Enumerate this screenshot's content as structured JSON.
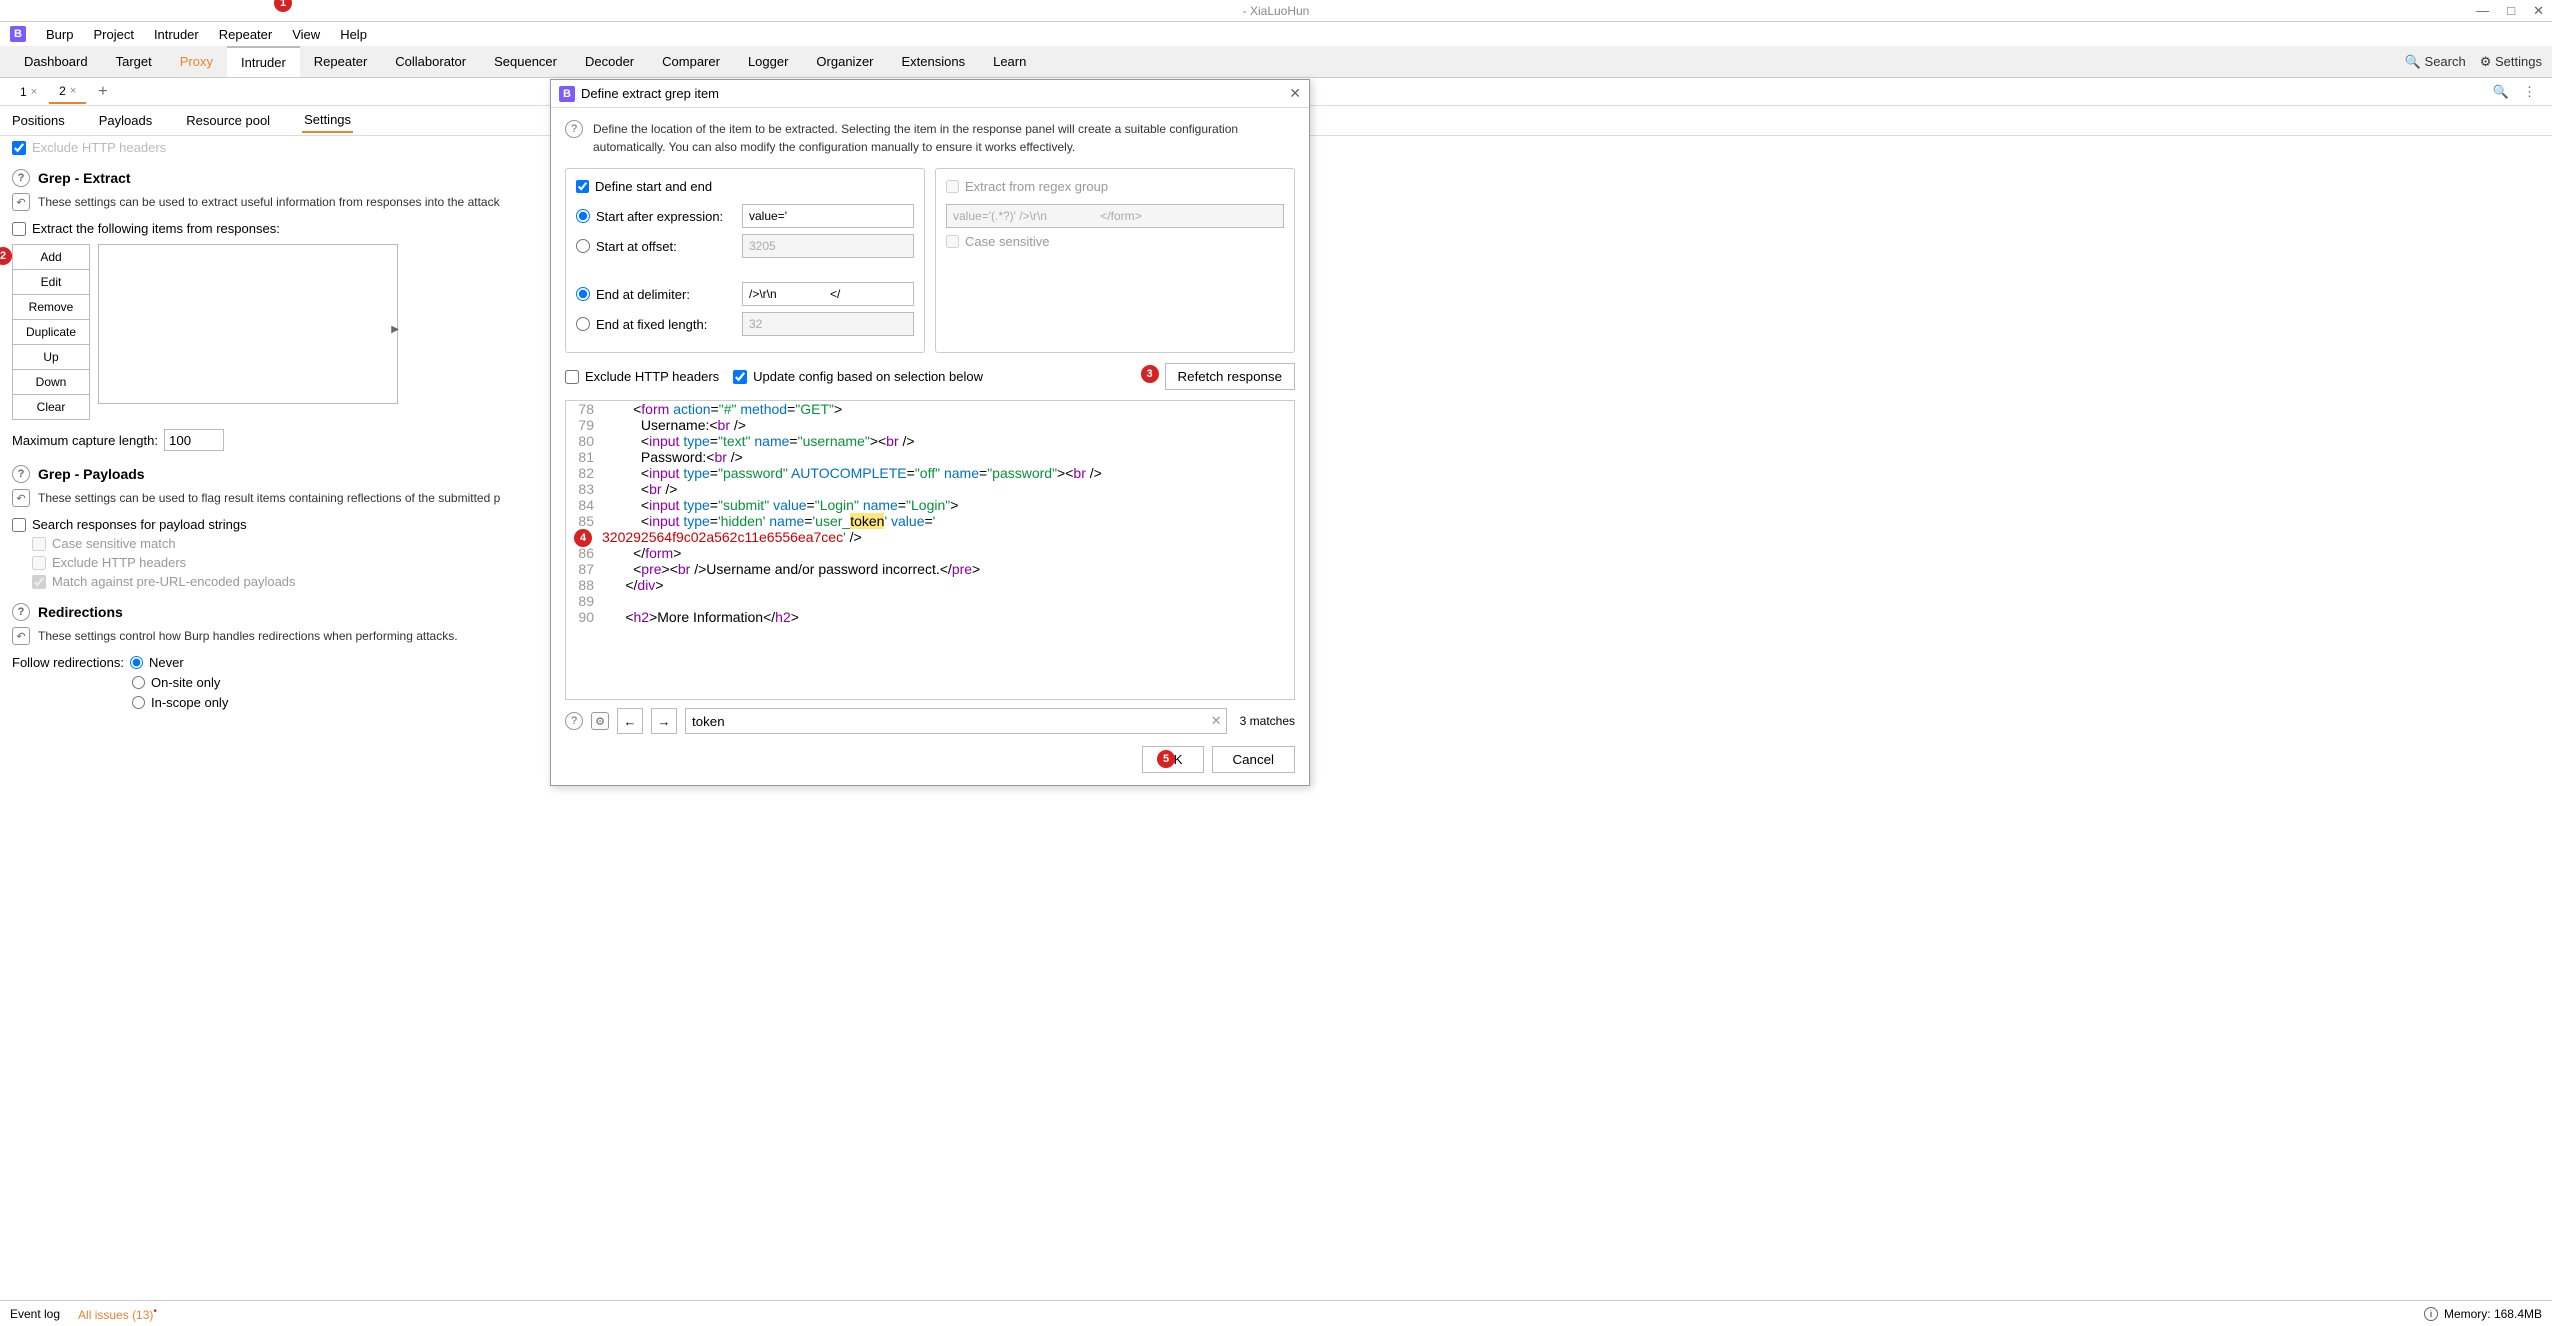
{
  "window": {
    "title": "- XiaLuoHun"
  },
  "menu": [
    "Burp",
    "Project",
    "Intruder",
    "Repeater",
    "View",
    "Help"
  ],
  "mainTabs": {
    "items": [
      "Dashboard",
      "Target",
      "Proxy",
      "Intruder",
      "Repeater",
      "Collaborator",
      "Sequencer",
      "Decoder",
      "Comparer",
      "Logger",
      "Organizer",
      "Extensions",
      "Learn"
    ],
    "search": "Search",
    "settings": "Settings"
  },
  "subTabs": {
    "t1": "1",
    "t2": "2"
  },
  "intruderTabs": [
    "Positions",
    "Payloads",
    "Resource pool",
    "Settings"
  ],
  "grepExtract": {
    "partialTop": "Exclude HTTP headers",
    "title": "Grep - Extract",
    "desc": "These settings can be used to extract useful information from responses into the attack",
    "extract": "Extract the following items from responses:",
    "buttons": {
      "add": "Add",
      "edit": "Edit",
      "remove": "Remove",
      "duplicate": "Duplicate",
      "up": "Up",
      "down": "Down",
      "clear": "Clear"
    },
    "maxCapLabel": "Maximum capture length:",
    "maxCap": "100"
  },
  "grepPayloads": {
    "title": "Grep - Payloads",
    "desc": "These settings can be used to flag result items containing reflections of the submitted p",
    "search": "Search responses for payload strings",
    "caseSens": "Case sensitive match",
    "excludeHdr": "Exclude HTTP headers",
    "matchPre": "Match against pre-URL-encoded payloads"
  },
  "redirections": {
    "title": "Redirections",
    "desc": "These settings control how Burp handles redirections when performing attacks.",
    "followLabel": "Follow redirections:",
    "opts": {
      "never": "Never",
      "onsite": "On-site only",
      "inscope": "In-scope only"
    }
  },
  "dialog": {
    "title": "Define extract grep item",
    "desc": "Define the location of the item to be extracted. Selecting the item in the response panel will create a suitable configuration automatically. You can also modify the configuration manually to ensure it works effectively.",
    "defineStartEnd": "Define start and end",
    "startAfterExpr": "Start after expression:",
    "startAfterVal": "value='",
    "startAtOffset": "Start at offset:",
    "startOffsetVal": "3205",
    "endAtDelim": "End at delimiter:",
    "endDelimVal": "/>\\r\\n                </",
    "endAtFixed": "End at fixed length:",
    "endFixedVal": "32",
    "extractRegex": "Extract from regex group",
    "regexVal": "value='(.*?)' />\\r\\n                </form>",
    "caseSensitive": "Case sensitive",
    "excludeHttp": "Exclude HTTP headers",
    "updateConfig": "Update config based on selection below",
    "refetch": "Refetch response",
    "searchVal": "token",
    "matches": "3 matches",
    "ok": "OK",
    "cancel": "Cancel",
    "code": {
      "l78": "        <form action=\"#\" method=\"GET\">",
      "l79": "          Username:<br />",
      "l80": "          <input type=\"text\" name=\"username\"><br />",
      "l81": "          Password:<br />",
      "l82": "          <input type=\"password\" AUTOCOMPLETE=\"off\" name=\"password\"><br />",
      "l83": "          <br />",
      "l84": "          <input type=\"submit\" value=\"Login\" name=\"Login\">",
      "l85": "          <input type='hidden' name='user_token' value='",
      "token": "320292564f9c02a562c11e6556ea7cec",
      "l85b": "' />",
      "l86": "        </form>",
      "l87": "        <pre><br />Username and/or password incorrect.</pre>",
      "l88": "      </div>",
      "l89": "",
      "l90": "      <h2>More Information</h2>"
    }
  },
  "status": {
    "eventLog": "Event log",
    "issues": "All issues (13)",
    "memory": "Memory: 168.4MB"
  }
}
